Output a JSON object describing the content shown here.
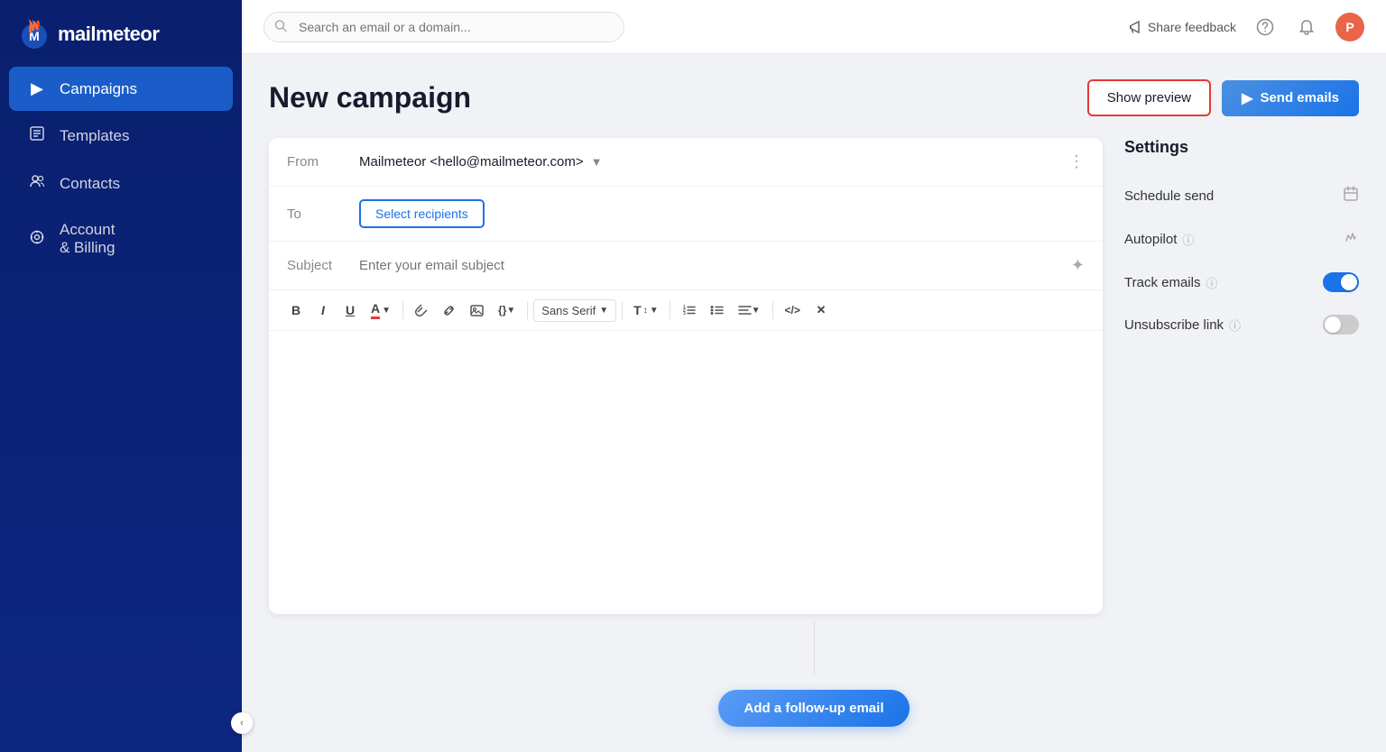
{
  "app": {
    "name": "mailmeteor"
  },
  "sidebar": {
    "items": [
      {
        "id": "campaigns",
        "label": "Campaigns",
        "icon": "▶",
        "active": true
      },
      {
        "id": "templates",
        "label": "Templates",
        "icon": "📄",
        "active": false
      },
      {
        "id": "contacts",
        "label": "Contacts",
        "icon": "👥",
        "active": false
      },
      {
        "id": "account-billing",
        "label": "Account & Billing",
        "icon": "⚙",
        "active": false
      }
    ],
    "collapse_label": "‹"
  },
  "topbar": {
    "search_placeholder": "Search an email or a domain...",
    "share_feedback_label": "Share feedback",
    "help_icon": "?",
    "notification_icon": "🔔",
    "avatar_initial": "P"
  },
  "page": {
    "title": "New campaign",
    "show_preview_label": "Show preview",
    "send_emails_label": "Send emails"
  },
  "composer": {
    "from_label": "From",
    "from_value": "Mailmeteor <hello@mailmeteor.com>",
    "to_label": "To",
    "select_recipients_label": "Select recipients",
    "subject_label": "Subject",
    "subject_placeholder": "Enter your email subject",
    "toolbar": {
      "bold": "B",
      "italic": "I",
      "underline": "U",
      "text_color": "A",
      "attachment": "📎",
      "link": "🔗",
      "image": "🖼",
      "variables": "{}",
      "font_family": "Sans Serif",
      "font_size": "T↕",
      "ordered_list": "≡",
      "unordered_list": "☰",
      "align": "≡",
      "code": "</>",
      "clear": "✕"
    }
  },
  "settings": {
    "title": "Settings",
    "items": [
      {
        "id": "schedule-send",
        "label": "Schedule send",
        "type": "icon",
        "icon": "📅"
      },
      {
        "id": "autopilot",
        "label": "Autopilot",
        "type": "icon",
        "icon": "✏",
        "has_info": true
      },
      {
        "id": "track-emails",
        "label": "Track emails",
        "type": "toggle",
        "value": true,
        "has_info": true
      },
      {
        "id": "unsubscribe-link",
        "label": "Unsubscribe link",
        "type": "toggle",
        "value": false,
        "has_info": true
      }
    ]
  },
  "footer": {
    "add_followup_label": "Add a follow-up email"
  }
}
